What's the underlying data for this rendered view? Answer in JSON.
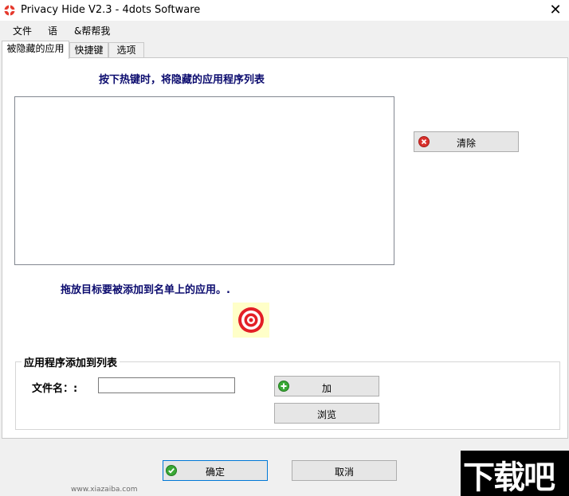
{
  "window": {
    "title": "Privacy Hide V2.3 - 4dots Software",
    "close_glyph": "✕"
  },
  "menu": [
    "文件",
    "语",
    "&帮帮我"
  ],
  "tabs": [
    "被隐藏的应用",
    "快捷键",
    "选项"
  ],
  "hidden_apps": {
    "heading": "按下热键时，将隐藏的应用程序列表",
    "items": [],
    "clear_button": "清除",
    "clear_icon": "red-x-circle-icon"
  },
  "drag": {
    "label": "拖放目标要被添加到名单上的应用。.",
    "target_icon": "bullseye-target-icon"
  },
  "add_group": {
    "title": "应用程序添加到列表",
    "filename_label": "文件名：:",
    "filename_value": "",
    "add_button": "加",
    "add_icon": "green-plus-circle-icon",
    "browse_button": "浏览"
  },
  "footer": {
    "ok_button": "确定",
    "ok_icon": "green-check-circle-icon",
    "cancel_button": "取消"
  },
  "watermark": {
    "text": "下载吧",
    "url": "www.xiazaiba.com"
  },
  "colors": {
    "heading_blue": "#0b0b6e",
    "target_red": "#e31f26",
    "target_bg": "#ffffc8"
  }
}
